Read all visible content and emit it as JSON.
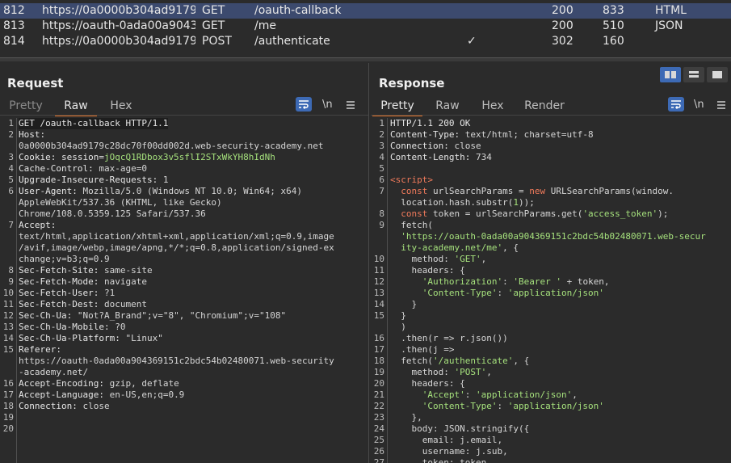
{
  "history": [
    {
      "num": "812",
      "host": "https://0a0000b304ad9179...",
      "method": "GET",
      "path": "/oauth-callback",
      "params": "",
      "status": "200",
      "length": "833",
      "mime": "HTML",
      "selected": true
    },
    {
      "num": "813",
      "host": "https://oauth-0ada00a9043...",
      "method": "GET",
      "path": "/me",
      "params": "",
      "status": "200",
      "length": "510",
      "mime": "JSON",
      "selected": false
    },
    {
      "num": "814",
      "host": "https://0a0000b304ad9179...",
      "method": "POST",
      "path": "/authenticate",
      "params": "✓",
      "status": "302",
      "length": "160",
      "mime": "",
      "selected": false
    }
  ],
  "request": {
    "title": "Request",
    "tabs": [
      "Pretty",
      "Raw",
      "Hex"
    ],
    "active_tab": "Raw",
    "newline_label": "\\n",
    "menu_icon": "hamburger-menu-icon",
    "lines": [
      {
        "n": "1",
        "parts": [
          [
            "k",
            "GET /oauth-callback HTTP/1.1"
          ]
        ]
      },
      {
        "n": "2",
        "parts": [
          [
            "k",
            "Host:"
          ]
        ]
      },
      {
        "n": "",
        "parts": [
          [
            "v",
            "0a0000b304ad9179c28dc70f00dd002d.web-security-academy.net"
          ]
        ]
      },
      {
        "n": "3",
        "parts": [
          [
            "k",
            "Cookie: "
          ],
          [
            "k",
            "session"
          ],
          [
            "k",
            "="
          ],
          [
            "cookie",
            "jOqcQ1RDbox3v5sflI2STxWkYH8hIdNh"
          ]
        ]
      },
      {
        "n": "4",
        "parts": [
          [
            "k",
            "Cache-Control: "
          ],
          [
            "v",
            "max-age=0"
          ]
        ]
      },
      {
        "n": "5",
        "parts": [
          [
            "k",
            "Upgrade-Insecure-Requests: "
          ],
          [
            "v",
            "1"
          ]
        ]
      },
      {
        "n": "6",
        "parts": [
          [
            "k",
            "User-Agent: "
          ],
          [
            "v",
            "Mozilla/5.0 (Windows NT 10.0; Win64; x64)"
          ]
        ]
      },
      {
        "n": "",
        "parts": [
          [
            "v",
            "AppleWebKit/537.36 (KHTML, like Gecko)"
          ]
        ]
      },
      {
        "n": "",
        "parts": [
          [
            "v",
            "Chrome/108.0.5359.125 Safari/537.36"
          ]
        ]
      },
      {
        "n": "7",
        "parts": [
          [
            "k",
            "Accept:"
          ]
        ]
      },
      {
        "n": "",
        "parts": [
          [
            "v",
            "text/html,application/xhtml+xml,application/xml;q=0.9,image"
          ]
        ]
      },
      {
        "n": "",
        "parts": [
          [
            "v",
            "/avif,image/webp,image/apng,*/*;q=0.8,application/signed-ex"
          ]
        ]
      },
      {
        "n": "",
        "parts": [
          [
            "v",
            "change;v=b3;q=0.9"
          ]
        ]
      },
      {
        "n": "8",
        "parts": [
          [
            "k",
            "Sec-Fetch-Site: "
          ],
          [
            "v",
            "same-site"
          ]
        ]
      },
      {
        "n": "9",
        "parts": [
          [
            "k",
            "Sec-Fetch-Mode: "
          ],
          [
            "v",
            "navigate"
          ]
        ]
      },
      {
        "n": "10",
        "parts": [
          [
            "k",
            "Sec-Fetch-User: "
          ],
          [
            "v",
            "?1"
          ]
        ]
      },
      {
        "n": "11",
        "parts": [
          [
            "k",
            "Sec-Fetch-Dest: "
          ],
          [
            "v",
            "document"
          ]
        ]
      },
      {
        "n": "12",
        "parts": [
          [
            "k",
            "Sec-Ch-Ua: "
          ],
          [
            "v",
            "\"Not?A_Brand\";v=\"8\", \"Chromium\";v=\"108\""
          ]
        ]
      },
      {
        "n": "13",
        "parts": [
          [
            "k",
            "Sec-Ch-Ua-Mobile: "
          ],
          [
            "v",
            "?0"
          ]
        ]
      },
      {
        "n": "14",
        "parts": [
          [
            "k",
            "Sec-Ch-Ua-Platform: "
          ],
          [
            "v",
            "\"Linux\""
          ]
        ]
      },
      {
        "n": "15",
        "parts": [
          [
            "k",
            "Referer:"
          ]
        ]
      },
      {
        "n": "",
        "parts": [
          [
            "v",
            "https://oauth-0ada00a904369151c2bdc54b02480071.web-security"
          ]
        ]
      },
      {
        "n": "",
        "parts": [
          [
            "v",
            "-academy.net/"
          ]
        ]
      },
      {
        "n": "16",
        "parts": [
          [
            "k",
            "Accept-Encoding: "
          ],
          [
            "v",
            "gzip, deflate"
          ]
        ]
      },
      {
        "n": "17",
        "parts": [
          [
            "k",
            "Accept-Language: "
          ],
          [
            "v",
            "en-US,en;q=0.9"
          ]
        ]
      },
      {
        "n": "18",
        "parts": [
          [
            "k",
            "Connection: "
          ],
          [
            "v",
            "close"
          ]
        ]
      },
      {
        "n": "19",
        "parts": [
          [
            "v",
            ""
          ]
        ]
      },
      {
        "n": "20",
        "parts": [
          [
            "v",
            ""
          ]
        ]
      }
    ]
  },
  "response": {
    "title": "Response",
    "tabs": [
      "Pretty",
      "Raw",
      "Hex",
      "Render"
    ],
    "active_tab": "Pretty",
    "newline_label": "\\n",
    "menu_icon": "hamburger-menu-icon",
    "lines": [
      {
        "n": "1",
        "parts": [
          [
            "k",
            "HTTP/1.1 200 OK"
          ]
        ]
      },
      {
        "n": "2",
        "parts": [
          [
            "k",
            "Content-Type: "
          ],
          [
            "v",
            "text/html; charset=utf-8"
          ]
        ]
      },
      {
        "n": "3",
        "parts": [
          [
            "k",
            "Connection: "
          ],
          [
            "v",
            "close"
          ]
        ]
      },
      {
        "n": "4",
        "parts": [
          [
            "k",
            "Content-Length: "
          ],
          [
            "v",
            "734"
          ]
        ]
      },
      {
        "n": "5",
        "parts": [
          [
            "v",
            ""
          ]
        ]
      },
      {
        "n": "6",
        "parts": [
          [
            "tag",
            "<script>"
          ]
        ]
      },
      {
        "n": "7",
        "parts": [
          [
            "v",
            "  "
          ],
          [
            "kw",
            "const"
          ],
          [
            "v",
            " urlSearchParams = "
          ],
          [
            "kw",
            "new"
          ],
          [
            "v",
            " URLSearchParams(window."
          ]
        ]
      },
      {
        "n": "",
        "parts": [
          [
            "v",
            "  location.hash.substr("
          ],
          [
            "s",
            "1"
          ],
          [
            "v",
            "));"
          ]
        ]
      },
      {
        "n": "8",
        "parts": [
          [
            "v",
            "  "
          ],
          [
            "kw",
            "const"
          ],
          [
            "v",
            " token = urlSearchParams.get("
          ],
          [
            "s",
            "'access_token'"
          ],
          [
            "v",
            ");"
          ]
        ]
      },
      {
        "n": "9",
        "parts": [
          [
            "v",
            "  fetch("
          ]
        ]
      },
      {
        "n": "",
        "parts": [
          [
            "v",
            "  "
          ],
          [
            "s",
            "'https://oauth-0ada00a904369151c2bdc54b02480071.web-secur"
          ]
        ]
      },
      {
        "n": "",
        "parts": [
          [
            "s",
            "  ity-academy.net/me'"
          ],
          [
            "v",
            ", {"
          ]
        ]
      },
      {
        "n": "10",
        "parts": [
          [
            "v",
            "    method: "
          ],
          [
            "s",
            "'GET'"
          ],
          [
            "v",
            ","
          ]
        ]
      },
      {
        "n": "11",
        "parts": [
          [
            "v",
            "    headers: {"
          ]
        ]
      },
      {
        "n": "12",
        "parts": [
          [
            "v",
            "      "
          ],
          [
            "s",
            "'Authorization'"
          ],
          [
            "v",
            ": "
          ],
          [
            "s",
            "'Bearer '"
          ],
          [
            "v",
            " + token,"
          ]
        ]
      },
      {
        "n": "13",
        "parts": [
          [
            "v",
            "      "
          ],
          [
            "s",
            "'Content-Type'"
          ],
          [
            "v",
            ": "
          ],
          [
            "s",
            "'application/json'"
          ]
        ]
      },
      {
        "n": "14",
        "parts": [
          [
            "v",
            "    }"
          ]
        ]
      },
      {
        "n": "15",
        "parts": [
          [
            "v",
            "  }"
          ]
        ]
      },
      {
        "n": "",
        "parts": [
          [
            "v",
            "  )"
          ]
        ]
      },
      {
        "n": "16",
        "parts": [
          [
            "v",
            "  .then(r => r.json())"
          ]
        ]
      },
      {
        "n": "17",
        "parts": [
          [
            "v",
            "  .then(j =>"
          ]
        ]
      },
      {
        "n": "18",
        "parts": [
          [
            "v",
            "  fetch("
          ],
          [
            "s",
            "'/authenticate'"
          ],
          [
            "v",
            ", {"
          ]
        ]
      },
      {
        "n": "19",
        "parts": [
          [
            "v",
            "    method: "
          ],
          [
            "s",
            "'POST'"
          ],
          [
            "v",
            ","
          ]
        ]
      },
      {
        "n": "20",
        "parts": [
          [
            "v",
            "    headers: {"
          ]
        ]
      },
      {
        "n": "21",
        "parts": [
          [
            "v",
            "      "
          ],
          [
            "s",
            "'Accept'"
          ],
          [
            "v",
            ": "
          ],
          [
            "s",
            "'application/json'"
          ],
          [
            "v",
            ","
          ]
        ]
      },
      {
        "n": "22",
        "parts": [
          [
            "v",
            "      "
          ],
          [
            "s",
            "'Content-Type'"
          ],
          [
            "v",
            ": "
          ],
          [
            "s",
            "'application/json'"
          ]
        ]
      },
      {
        "n": "23",
        "parts": [
          [
            "v",
            "    },"
          ]
        ]
      },
      {
        "n": "24",
        "parts": [
          [
            "v",
            "    body: JSON.stringify({"
          ]
        ]
      },
      {
        "n": "25",
        "parts": [
          [
            "v",
            "      email: j.email,"
          ]
        ]
      },
      {
        "n": "26",
        "parts": [
          [
            "v",
            "      username: j.sub,"
          ]
        ]
      },
      {
        "n": "27",
        "parts": [
          [
            "v",
            "      token: token"
          ]
        ]
      }
    ]
  },
  "view_buttons": [
    "split-vertical-icon",
    "split-horizontal-icon",
    "single-pane-icon"
  ],
  "colors": {
    "accent": "#e8762b",
    "selection": "#3c4a6e",
    "button": "#3d6ab5",
    "string": "#a5e07c",
    "keyword": "#f07a5b"
  }
}
